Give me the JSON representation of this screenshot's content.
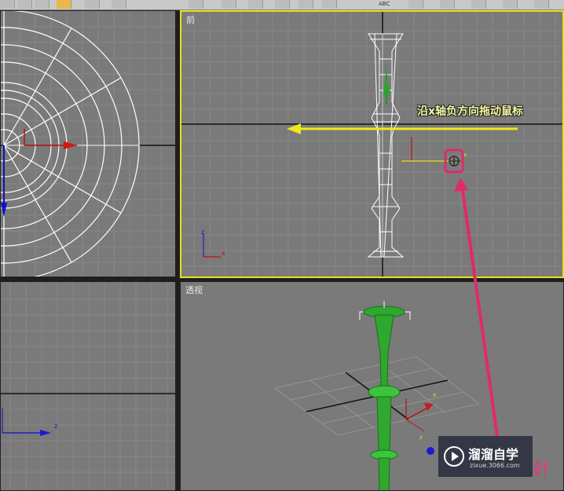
{
  "toolbar": {
    "text_label": "ABC"
  },
  "viewports": {
    "top": {
      "label": ""
    },
    "front": {
      "label": "前",
      "axis_z": "z",
      "axis_x": "x",
      "gizmo_x": "x"
    },
    "left": {
      "label": "",
      "axis_z": "z"
    },
    "perspective": {
      "label": "透视",
      "gizmo_x": "x",
      "gizmo_z": "z"
    }
  },
  "annotation": {
    "text": "沿x轴负方向拖动鼠标"
  },
  "watermark": {
    "title": "溜溜自学",
    "url": "zixue.3066.com",
    "suffix": "針"
  },
  "colors": {
    "viewport_bg": "#7a7a7a",
    "active_border": "#e6e01c",
    "grid": "#8a8a8a",
    "arrow_yellow": "#f0e81a",
    "highlight_pink": "#e02a6a",
    "model_green": "#2ea82e"
  }
}
